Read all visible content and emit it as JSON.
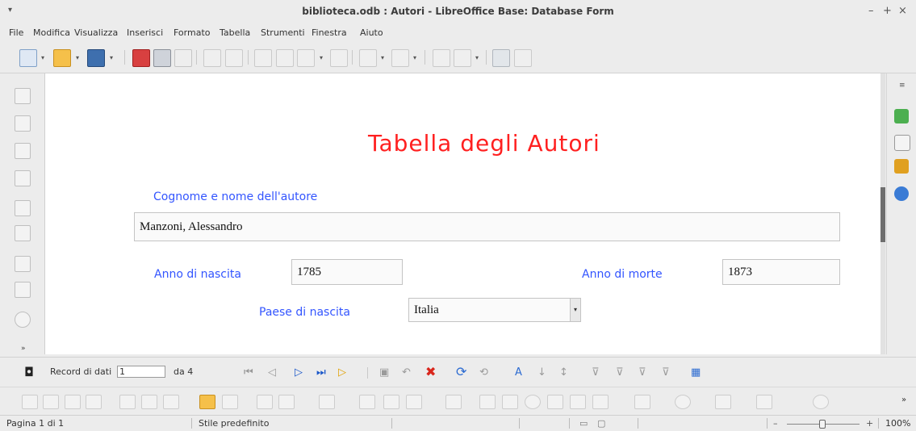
{
  "window": {
    "title": "biblioteca.odb : Autori - LibreOffice Base: Database Form",
    "controls": [
      "–",
      "+",
      "×"
    ]
  },
  "menubar": {
    "items": [
      "File",
      "Modifica",
      "Visualizza",
      "Inserisci",
      "Formato",
      "Tabella",
      "Strumenti",
      "Finestra",
      "Aiuto"
    ]
  },
  "form": {
    "title": "Tabella degli Autori",
    "author_label": "Cognome e nome dell'autore",
    "author_value": "Manzoni, Alessandro",
    "birth_year_label": "Anno di nascita",
    "birth_year_value": "1785",
    "death_year_label": "Anno di morte",
    "death_year_value": "1873",
    "country_label": "Paese di nascita",
    "country_value": "Italia"
  },
  "navigation": {
    "record_label": "Record di dati",
    "record_value": "1",
    "of_label": "da 4"
  },
  "statusbar": {
    "page": "Pagina 1 di 1",
    "style": "Stile predefinito",
    "zoom": "100%"
  },
  "colors": {
    "form_title": "#ff2020",
    "labels": "#3355ff"
  }
}
